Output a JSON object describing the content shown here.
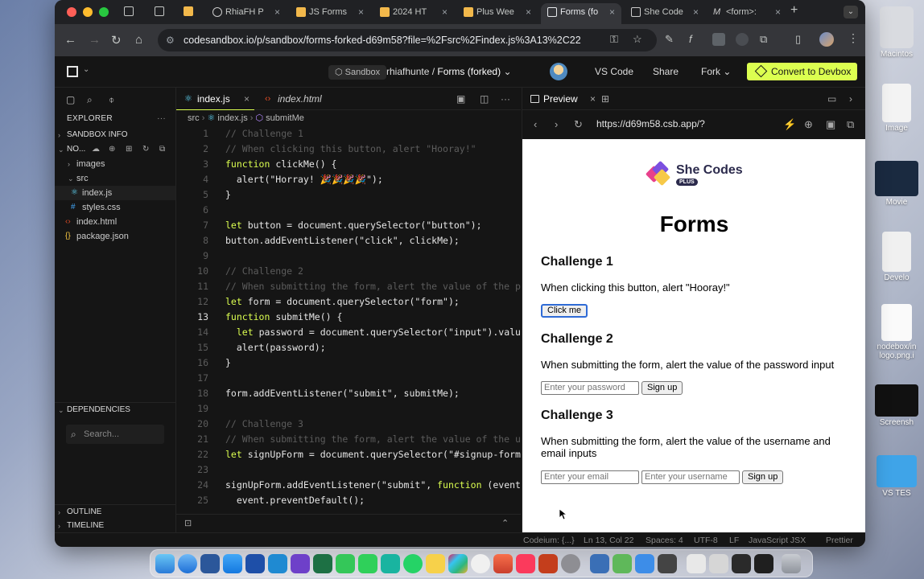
{
  "browser": {
    "tabs": [
      {
        "label": "RhiaFH P"
      },
      {
        "label": "JS Forms"
      },
      {
        "label": "2024 HT"
      },
      {
        "label": "Plus Wee"
      },
      {
        "label": "Forms (fo"
      },
      {
        "label": "She Code"
      },
      {
        "label": "<form>: "
      }
    ],
    "url": "codesandbox.io/p/sandbox/forms-forked-d69m58?file=%2Fsrc%2Findex.js%3A13%2C22"
  },
  "header": {
    "sandbox_badge": "Sandbox",
    "owner": "rhiafhunte",
    "separator": "/",
    "project": "Forms (forked)",
    "vscode": "VS Code",
    "share": "Share",
    "fork": "Fork",
    "convert": "Convert to Devbox"
  },
  "sidebar": {
    "explorer": "EXPLORER",
    "sandbox_info": "SANDBOX INFO",
    "root": "NO...",
    "tree": [
      {
        "label": "images",
        "type": "folder"
      },
      {
        "label": "src",
        "type": "folder-open"
      },
      {
        "label": "index.js",
        "type": "js"
      },
      {
        "label": "styles.css",
        "type": "css"
      },
      {
        "label": "index.html",
        "type": "html"
      },
      {
        "label": "package.json",
        "type": "json"
      }
    ],
    "dependencies": "DEPENDENCIES",
    "search_placeholder": "Search...",
    "outline": "OUTLINE",
    "timeline": "TIMELINE"
  },
  "editor": {
    "tabs": [
      {
        "label": "index.js"
      },
      {
        "label": "index.html"
      }
    ],
    "breadcrumb": {
      "src": "src",
      "file": "index.js",
      "symbol": "submitMe"
    },
    "lines": [
      {
        "n": "1",
        "text": "// Challenge 1"
      },
      {
        "n": "2",
        "text": "// When clicking this button, alert \"Hooray!\""
      },
      {
        "n": "3",
        "text": "function clickMe() {"
      },
      {
        "n": "4",
        "text": "  alert(\"Horray! 🎉🎉🎉🎉\");"
      },
      {
        "n": "5",
        "text": "}"
      },
      {
        "n": "6",
        "text": ""
      },
      {
        "n": "7",
        "text": "let button = document.querySelector(\"button\");"
      },
      {
        "n": "8",
        "text": "button.addEventListener(\"click\", clickMe);"
      },
      {
        "n": "9",
        "text": ""
      },
      {
        "n": "10",
        "text": "// Challenge 2"
      },
      {
        "n": "11",
        "text": "// When submitting the form, alert the value of the p"
      },
      {
        "n": "12",
        "text": "let form = document.querySelector(\"form\");"
      },
      {
        "n": "13",
        "text": "function submitMe() {"
      },
      {
        "n": "14",
        "text": "  let password = document.querySelector(\"input\").valu"
      },
      {
        "n": "15",
        "text": "  alert(password);"
      },
      {
        "n": "16",
        "text": "}"
      },
      {
        "n": "17",
        "text": ""
      },
      {
        "n": "18",
        "text": "form.addEventListener(\"submit\", submitMe);"
      },
      {
        "n": "19",
        "text": ""
      },
      {
        "n": "20",
        "text": "// Challenge 3"
      },
      {
        "n": "21",
        "text": "// When submitting the form, alert the value of the u"
      },
      {
        "n": "22",
        "text": "let signUpForm = document.querySelector(\"#signup-form"
      },
      {
        "n": "23",
        "text": ""
      },
      {
        "n": "24",
        "text": "signUpForm.addEventListener(\"submit\", function (event"
      },
      {
        "n": "25",
        "text": "  event.preventDefault();"
      }
    ]
  },
  "preview": {
    "tab_label": "Preview",
    "url": "https://d69m58.csb.app/?",
    "page": {
      "logo_text": "She Codes",
      "logo_plus": "PLUS",
      "title": "Forms",
      "c1_title": "Challenge 1",
      "c1_text": "When clicking this button, alert \"Hooray!\"",
      "c1_button": "Click me",
      "c2_title": "Challenge 2",
      "c2_text": "When submitting the form, alert the value of the password input",
      "c2_placeholder": "Enter your password",
      "c2_button": "Sign up",
      "c3_title": "Challenge 3",
      "c3_text": "When submitting the form, alert the value of the username and email inputs",
      "c3_email_placeholder": "Enter your email",
      "c3_username_placeholder": "Enter your username",
      "c3_button": "Sign up"
    }
  },
  "statusbar": {
    "codeium": "Codeium: {...}",
    "position": "Ln 13, Col 22",
    "spaces": "Spaces: 4",
    "encoding": "UTF-8",
    "eol": "LF",
    "language": "JavaScript JSX",
    "prettier": "Prettier"
  },
  "desktop": {
    "items": [
      {
        "label": "Macintos"
      },
      {
        "label": "Image"
      },
      {
        "label": "Movie"
      },
      {
        "label": "Develo"
      },
      {
        "label": "nodebox/in logo.png.i"
      },
      {
        "label": "Screensh"
      },
      {
        "label": "VS TES"
      }
    ]
  }
}
